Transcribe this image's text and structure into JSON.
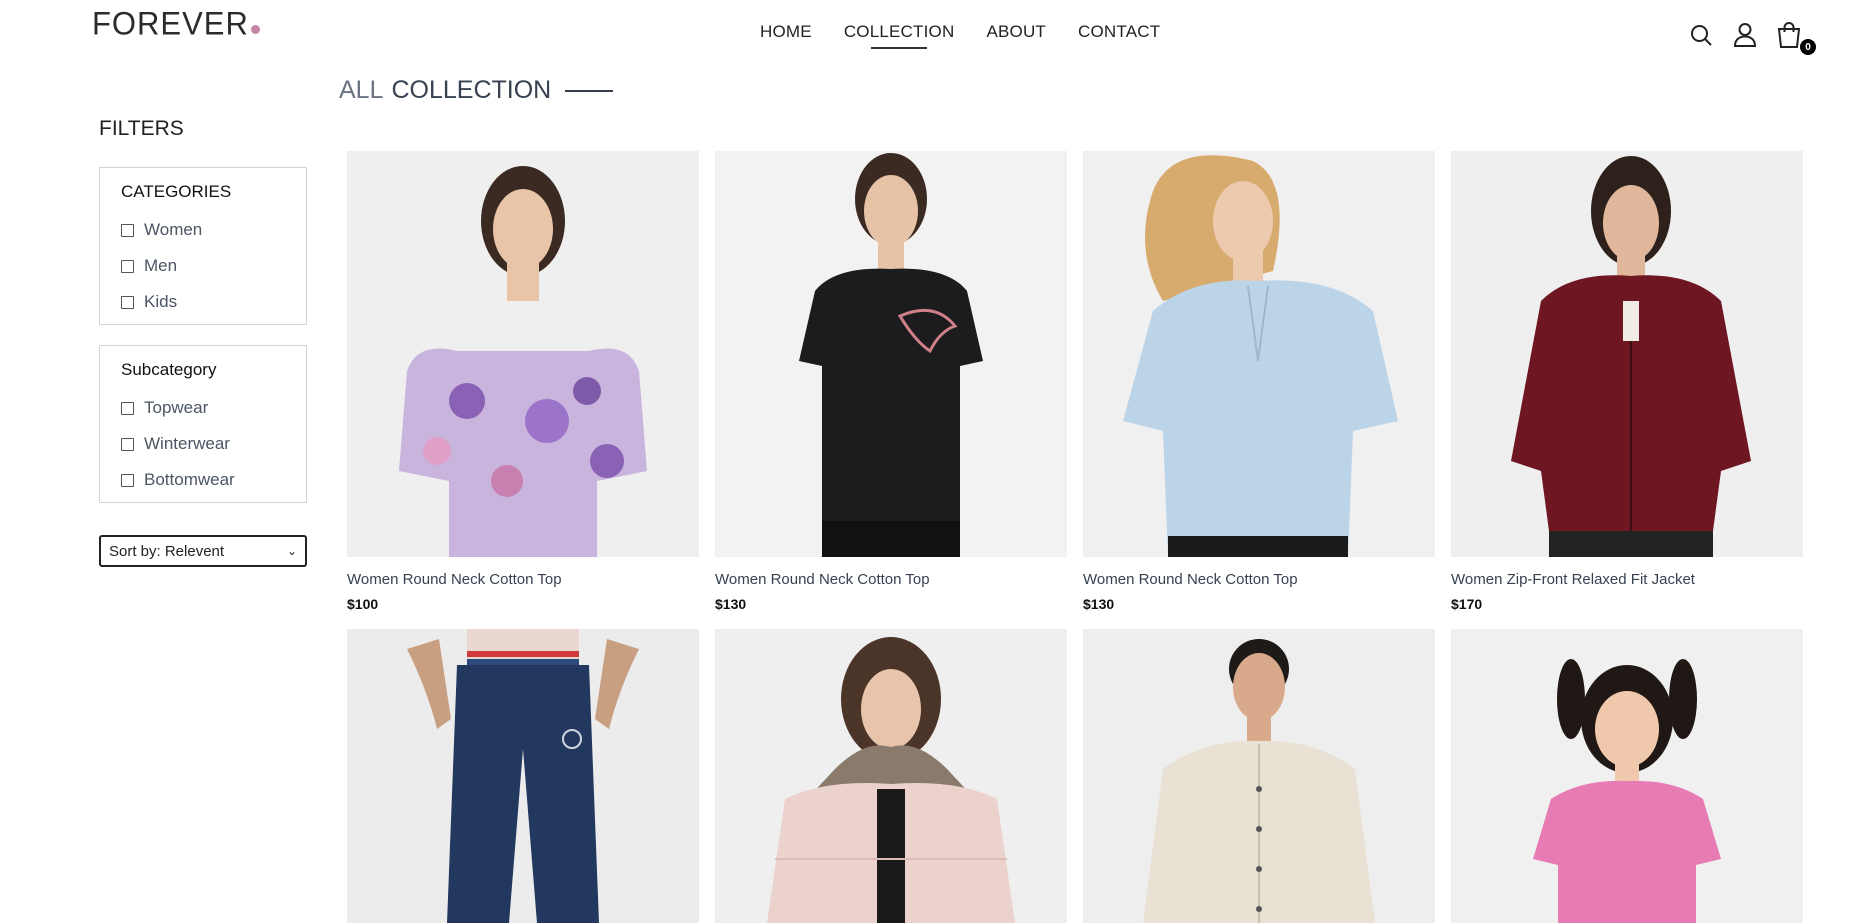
{
  "brand": {
    "logo_text": "FOREVER",
    "accent": "#c586a5"
  },
  "nav": [
    {
      "label": "HOME",
      "active": false
    },
    {
      "label": "COLLECTION",
      "active": true
    },
    {
      "label": "ABOUT",
      "active": false
    },
    {
      "label": "CONTACT",
      "active": false
    }
  ],
  "header_icons": {
    "search": "search-icon",
    "profile": "profile-icon",
    "cart": "cart-icon",
    "cart_count": "0"
  },
  "title": {
    "part1": "ALL",
    "part2": "COLLECTION"
  },
  "filters": {
    "heading": "FILTERS",
    "categories": {
      "title": "CATEGORIES",
      "options": [
        "Women",
        "Men",
        "Kids"
      ]
    },
    "subcategory": {
      "title": "Subcategory",
      "options": [
        "Topwear",
        "Winterwear",
        "Bottomwear"
      ]
    },
    "sort": {
      "selected": "Sort by: Relevent"
    }
  },
  "products": [
    {
      "name": "Women Round Neck Cotton Top",
      "price": "$100"
    },
    {
      "name": "Women Round Neck Cotton Top",
      "price": "$130"
    },
    {
      "name": "Women Round Neck Cotton Top",
      "price": "$130"
    },
    {
      "name": "Women Zip-Front Relaxed Fit Jacket",
      "price": "$170"
    },
    {
      "name": "",
      "price": ""
    },
    {
      "name": "",
      "price": ""
    },
    {
      "name": "",
      "price": ""
    },
    {
      "name": "",
      "price": ""
    }
  ]
}
